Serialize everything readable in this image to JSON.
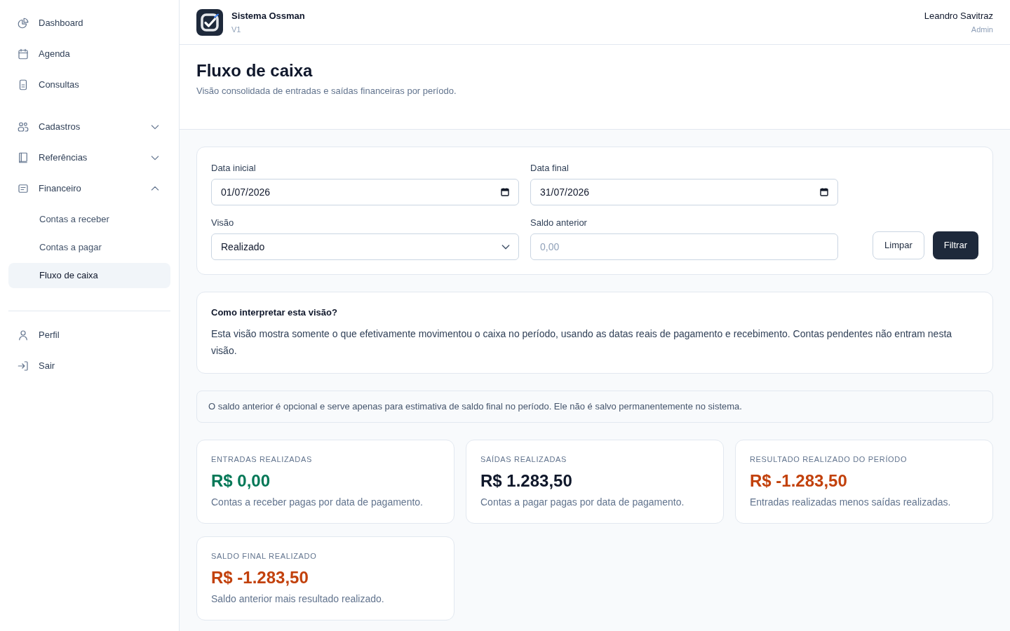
{
  "sidebar": {
    "sections": [
      {
        "items": [
          {
            "kind": "link",
            "label": "Dashboard",
            "selected": false
          },
          {
            "kind": "link",
            "label": "Agenda",
            "selected": false
          },
          {
            "kind": "link",
            "label": "Consultas",
            "selected": false
          }
        ]
      },
      {
        "items": [
          {
            "kind": "group",
            "label": "Cadastros",
            "selected": false,
            "expanded": false
          },
          {
            "kind": "group",
            "label": "Referências",
            "selected": false,
            "expanded": false
          },
          {
            "kind": "group",
            "label": "Financeiro",
            "selected": false,
            "expanded": true,
            "children": [
              {
                "label": "Contas a receber",
                "selected": false
              },
              {
                "label": "Contas a pagar",
                "selected": false
              },
              {
                "label": "Fluxo de caixa",
                "selected": true
              }
            ]
          }
        ]
      }
    ],
    "bottom_items": [
      {
        "label": "Perfil",
        "selected": false
      },
      {
        "label": "Sair",
        "selected": false
      }
    ]
  },
  "header": {
    "app_name": "Sistema Ossman",
    "version": "V1",
    "user_name": "Leandro Savitraz",
    "user_role": "Admin"
  },
  "page": {
    "title": "Fluxo de caixa",
    "subtitle": "Visão consolidada de entradas e saídas financeiras por período."
  },
  "filters": {
    "rows": [
      {
        "fields": [
          {
            "kind": "date",
            "label": "Data inicial",
            "value": "01/07/2026"
          },
          {
            "kind": "date",
            "label": "Data final",
            "value": "31/07/2026"
          }
        ]
      },
      {
        "fields": [
          {
            "kind": "select",
            "label": "Visão",
            "value": "Realizado"
          },
          {
            "kind": "text",
            "label": "Saldo anterior",
            "placeholder": "0,00"
          }
        ]
      }
    ],
    "buttons": [
      {
        "kind": "secondary",
        "label": "Limpar"
      },
      {
        "kind": "primary",
        "label": "Filtrar"
      }
    ]
  },
  "info": {
    "title": "Como interpretar esta visão?",
    "text": "Esta visão mostra somente o que efetivamente movimentou o caixa no período, usando as datas reais de pagamento e recebimento. Contas pendentes não entram nesta visão."
  },
  "note": {
    "text": "O saldo anterior é opcional e serve apenas para estimativa de saldo final no período. Ele não é salvo permanentemente no sistema."
  },
  "stats": [
    {
      "label": "ENTRADAS REALIZADAS",
      "value": "R$ 0,00",
      "color": "#047857",
      "description": "Contas a receber pagas por data de pagamento."
    },
    {
      "label": "SAÍDAS REALIZADAS",
      "value": "R$ 1.283,50",
      "color": "#0f172a",
      "description": "Contas a pagar pagas por data de pagamento."
    },
    {
      "label": "RESULTADO REALIZADO DO PERÍODO",
      "value": "R$ -1.283,50",
      "color": "#c2410c",
      "description": "Entradas realizadas menos saídas realizadas."
    },
    {
      "label": "SALDO FINAL REALIZADO",
      "value": "R$ -1.283,50",
      "color": "#c2410c",
      "description": "Saldo anterior mais resultado realizado."
    }
  ]
}
